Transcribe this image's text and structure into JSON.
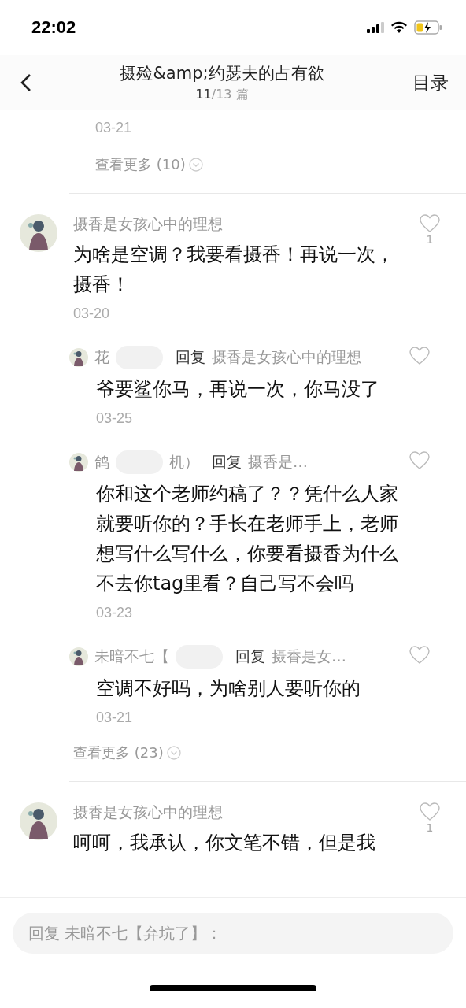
{
  "status_bar": {
    "time": "22:02"
  },
  "header": {
    "title": "摄殓&amp;约瑟夫的占有欲",
    "current": "11",
    "total": "/13 篇",
    "toc": "目录"
  },
  "previous_thread": {
    "date": "03-21",
    "more": "查看更多 (10)"
  },
  "comments": [
    {
      "author": "摄香是女孩心中的理想",
      "text": "为啥是空调？我要看摄香！再说一次，摄香！",
      "date": "03-20",
      "likes": "1",
      "replies": [
        {
          "author": "花",
          "redacted": true,
          "reply_label": "回复",
          "reply_to": "摄香是女孩心中的理想",
          "text": "爷要鲨你马，再说一次，你马没了",
          "date": "03-25"
        },
        {
          "author": "鸽",
          "redacted": true,
          "author_tail": "机）",
          "reply_label": "回复",
          "reply_to": "摄香是…",
          "text": "你和这个老师约稿了？？凭什么人家就要听你的？手长在老师手上，老师想写什么写什么，你要看摄香为什么不去你tag里看？自己写不会吗",
          "date": "03-23"
        },
        {
          "author": "未暗不七【",
          "redacted": true,
          "reply_label": "回复",
          "reply_to": "摄香是女…",
          "text": "空调不好吗，为啥别人要听你的",
          "date": "03-21"
        }
      ],
      "more": "查看更多 (23)"
    },
    {
      "author": "摄香是女孩心中的理想",
      "text": "呵呵，我承认，你文笔不错，但是我",
      "likes": "1"
    }
  ],
  "reply_input": {
    "placeholder": "回复 未暗不七【弃坑了】："
  }
}
